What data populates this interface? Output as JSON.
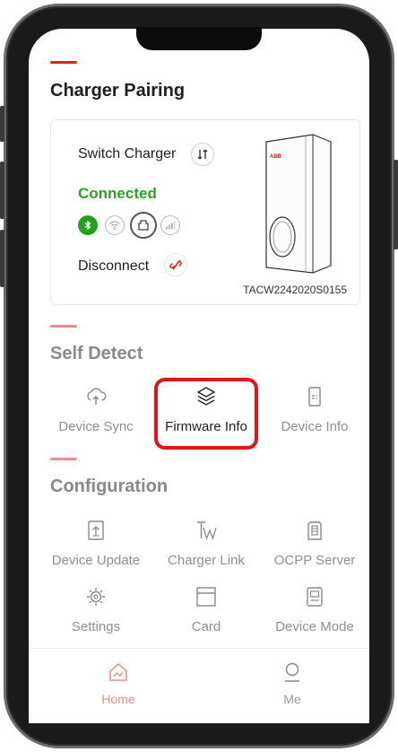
{
  "header": {
    "title": "Charger Pairing"
  },
  "charger_card": {
    "switch_label": "Switch Charger",
    "status": "Connected",
    "disconnect_label": "Disconnect",
    "serial": "TACW2242020S0155",
    "brand_logo": "ABB"
  },
  "self_detect": {
    "title": "Self Detect",
    "items": [
      {
        "label": "Device Sync",
        "icon": "cloud-sync-icon"
      },
      {
        "label": "Firmware Info",
        "icon": "layers-icon"
      },
      {
        "label": "Device Info",
        "icon": "device-info-icon"
      }
    ]
  },
  "configuration": {
    "title": "Configuration",
    "items": [
      {
        "label": "Device Update",
        "icon": "upload-icon"
      },
      {
        "label": "Charger Link",
        "icon": "charger-link-icon"
      },
      {
        "label": "OCPP Server",
        "icon": "server-icon"
      },
      {
        "label": "Settings",
        "icon": "gear-icon"
      },
      {
        "label": "Card",
        "icon": "card-icon"
      },
      {
        "label": "Device Mode",
        "icon": "device-mode-icon"
      }
    ]
  },
  "tabbar": {
    "items": [
      {
        "label": "Home",
        "icon": "home-icon",
        "active": true
      },
      {
        "label": "Me",
        "icon": "profile-icon",
        "active": false
      }
    ]
  },
  "colors": {
    "accent": "#e2231a",
    "connected": "#2aa52a",
    "muted": "#8f8f8f",
    "highlight_border": "#e2141a"
  }
}
